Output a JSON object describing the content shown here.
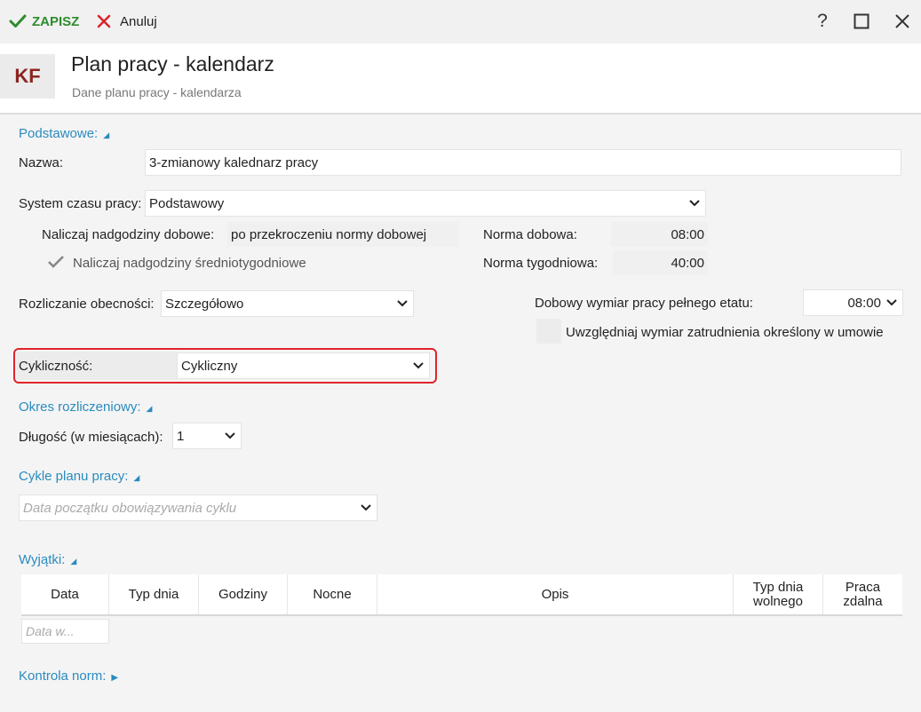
{
  "toolbar": {
    "save_label": "ZAPISZ",
    "cancel_label": "Anuluj",
    "help_label": "?"
  },
  "header": {
    "badge": "KF",
    "title": "Plan pracy - kalendarz",
    "subtitle": "Dane planu pracy - kalendarza"
  },
  "basic": {
    "section_label": "Podstawowe:",
    "name_label": "Nazwa:",
    "name_value": "3-zmianowy kalednarz pracy",
    "system_label": "System czasu pracy:",
    "system_value": "Podstawowy",
    "overtime_label": "Naliczaj nadgodziny dobowe:",
    "overtime_value": "po przekroczeniu normy dobowej",
    "weekly_overtime_label": "Naliczaj nadgodziny średniotygodniowe",
    "weekly_overtime_checked": true,
    "daily_norm_label": "Norma dobowa:",
    "daily_norm_value": "08:00",
    "weekly_norm_label": "Norma tygodniowa:",
    "weekly_norm_value": "40:00",
    "attendance_label": "Rozliczanie obecności:",
    "attendance_value": "Szczegółowo",
    "daily_dim_label": "Dobowy wymiar pracy pełnego etatu:",
    "daily_dim_value": "08:00",
    "contract_dim_label": "Uwzględniaj wymiar zatrudnienia określony w umowie",
    "contract_dim_checked": false,
    "cyclic_label": "Cykliczność:",
    "cyclic_value": "Cykliczny"
  },
  "period": {
    "section_label": "Okres rozliczeniowy:",
    "length_label": "Długość (w miesiącach):",
    "length_value": "1"
  },
  "cycles": {
    "section_label": "Cykle planu pracy:",
    "date_placeholder": "Data początku obowiązywania cyklu"
  },
  "exceptions": {
    "section_label": "Wyjątki:",
    "columns": [
      "Data",
      "Typ dnia",
      "Godziny",
      "Nocne",
      "Opis",
      "Typ dnia wolnego",
      "Praca zdalna"
    ],
    "date_placeholder": "Data w..."
  },
  "norms": {
    "section_label": "Kontrola norm:"
  },
  "colors": {
    "accent": "#2a8bbf",
    "save_green": "#2e8b2e",
    "cancel_red": "#d9262c",
    "highlight_red": "#e0242b",
    "badge_red": "#8b2520"
  }
}
